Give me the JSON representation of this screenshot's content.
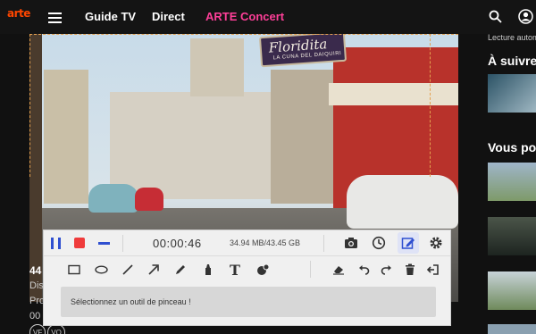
{
  "nav": {
    "logo": "arte",
    "items": [
      "Guide TV",
      "Direct",
      "ARTE Concert"
    ],
    "accent_color": "#ff3f99",
    "logo_color": "#fd4600"
  },
  "video": {
    "sign_main": "Floridita",
    "sign_sub": "LA CUNA DEL DAIQUIRI"
  },
  "page_info": {
    "title": "44",
    "line1": "Dis",
    "line2": "Pro",
    "line3": "00",
    "badges": [
      "VF",
      "VO"
    ]
  },
  "sidebar": {
    "top_text": "Lecture autom",
    "heading1": "À suivre",
    "heading2": "Vous pou"
  },
  "recorder": {
    "timer": "00:00:46",
    "file_size": "34.94 MB/43.45 GB",
    "hint": "Sélectionnez un outil de pinceau !",
    "text_tool_glyph": "T",
    "top_icons": [
      "camera-icon",
      "clock-icon",
      "edit-icon",
      "gear-icon"
    ],
    "tools": [
      "rectangle",
      "ellipse",
      "line",
      "arrow",
      "pencil",
      "marker",
      "text",
      "step-number"
    ],
    "actions": [
      "eraser",
      "undo",
      "redo",
      "delete",
      "exit"
    ],
    "colors": {
      "pause": "#2f4fd0",
      "stop": "#ef3b3b",
      "active": "#2f4fd0"
    }
  }
}
